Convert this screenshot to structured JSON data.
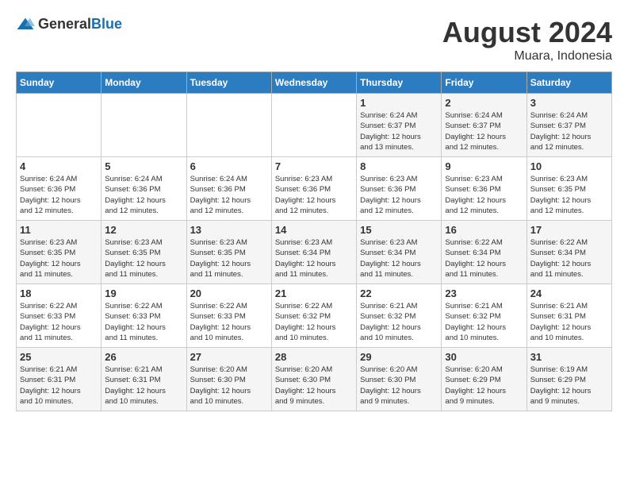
{
  "header": {
    "logo_general": "General",
    "logo_blue": "Blue",
    "month_year": "August 2024",
    "location": "Muara, Indonesia"
  },
  "days_of_week": [
    "Sunday",
    "Monday",
    "Tuesday",
    "Wednesday",
    "Thursday",
    "Friday",
    "Saturday"
  ],
  "weeks": [
    [
      {
        "day": "",
        "info": ""
      },
      {
        "day": "",
        "info": ""
      },
      {
        "day": "",
        "info": ""
      },
      {
        "day": "",
        "info": ""
      },
      {
        "day": "1",
        "info": "Sunrise: 6:24 AM\nSunset: 6:37 PM\nDaylight: 12 hours\nand 13 minutes."
      },
      {
        "day": "2",
        "info": "Sunrise: 6:24 AM\nSunset: 6:37 PM\nDaylight: 12 hours\nand 12 minutes."
      },
      {
        "day": "3",
        "info": "Sunrise: 6:24 AM\nSunset: 6:37 PM\nDaylight: 12 hours\nand 12 minutes."
      }
    ],
    [
      {
        "day": "4",
        "info": "Sunrise: 6:24 AM\nSunset: 6:36 PM\nDaylight: 12 hours\nand 12 minutes."
      },
      {
        "day": "5",
        "info": "Sunrise: 6:24 AM\nSunset: 6:36 PM\nDaylight: 12 hours\nand 12 minutes."
      },
      {
        "day": "6",
        "info": "Sunrise: 6:24 AM\nSunset: 6:36 PM\nDaylight: 12 hours\nand 12 minutes."
      },
      {
        "day": "7",
        "info": "Sunrise: 6:23 AM\nSunset: 6:36 PM\nDaylight: 12 hours\nand 12 minutes."
      },
      {
        "day": "8",
        "info": "Sunrise: 6:23 AM\nSunset: 6:36 PM\nDaylight: 12 hours\nand 12 minutes."
      },
      {
        "day": "9",
        "info": "Sunrise: 6:23 AM\nSunset: 6:36 PM\nDaylight: 12 hours\nand 12 minutes."
      },
      {
        "day": "10",
        "info": "Sunrise: 6:23 AM\nSunset: 6:35 PM\nDaylight: 12 hours\nand 12 minutes."
      }
    ],
    [
      {
        "day": "11",
        "info": "Sunrise: 6:23 AM\nSunset: 6:35 PM\nDaylight: 12 hours\nand 11 minutes."
      },
      {
        "day": "12",
        "info": "Sunrise: 6:23 AM\nSunset: 6:35 PM\nDaylight: 12 hours\nand 11 minutes."
      },
      {
        "day": "13",
        "info": "Sunrise: 6:23 AM\nSunset: 6:35 PM\nDaylight: 12 hours\nand 11 minutes."
      },
      {
        "day": "14",
        "info": "Sunrise: 6:23 AM\nSunset: 6:34 PM\nDaylight: 12 hours\nand 11 minutes."
      },
      {
        "day": "15",
        "info": "Sunrise: 6:23 AM\nSunset: 6:34 PM\nDaylight: 12 hours\nand 11 minutes."
      },
      {
        "day": "16",
        "info": "Sunrise: 6:22 AM\nSunset: 6:34 PM\nDaylight: 12 hours\nand 11 minutes."
      },
      {
        "day": "17",
        "info": "Sunrise: 6:22 AM\nSunset: 6:34 PM\nDaylight: 12 hours\nand 11 minutes."
      }
    ],
    [
      {
        "day": "18",
        "info": "Sunrise: 6:22 AM\nSunset: 6:33 PM\nDaylight: 12 hours\nand 11 minutes."
      },
      {
        "day": "19",
        "info": "Sunrise: 6:22 AM\nSunset: 6:33 PM\nDaylight: 12 hours\nand 11 minutes."
      },
      {
        "day": "20",
        "info": "Sunrise: 6:22 AM\nSunset: 6:33 PM\nDaylight: 12 hours\nand 10 minutes."
      },
      {
        "day": "21",
        "info": "Sunrise: 6:22 AM\nSunset: 6:32 PM\nDaylight: 12 hours\nand 10 minutes."
      },
      {
        "day": "22",
        "info": "Sunrise: 6:21 AM\nSunset: 6:32 PM\nDaylight: 12 hours\nand 10 minutes."
      },
      {
        "day": "23",
        "info": "Sunrise: 6:21 AM\nSunset: 6:32 PM\nDaylight: 12 hours\nand 10 minutes."
      },
      {
        "day": "24",
        "info": "Sunrise: 6:21 AM\nSunset: 6:31 PM\nDaylight: 12 hours\nand 10 minutes."
      }
    ],
    [
      {
        "day": "25",
        "info": "Sunrise: 6:21 AM\nSunset: 6:31 PM\nDaylight: 12 hours\nand 10 minutes."
      },
      {
        "day": "26",
        "info": "Sunrise: 6:21 AM\nSunset: 6:31 PM\nDaylight: 12 hours\nand 10 minutes."
      },
      {
        "day": "27",
        "info": "Sunrise: 6:20 AM\nSunset: 6:30 PM\nDaylight: 12 hours\nand 10 minutes."
      },
      {
        "day": "28",
        "info": "Sunrise: 6:20 AM\nSunset: 6:30 PM\nDaylight: 12 hours\nand 9 minutes."
      },
      {
        "day": "29",
        "info": "Sunrise: 6:20 AM\nSunset: 6:30 PM\nDaylight: 12 hours\nand 9 minutes."
      },
      {
        "day": "30",
        "info": "Sunrise: 6:20 AM\nSunset: 6:29 PM\nDaylight: 12 hours\nand 9 minutes."
      },
      {
        "day": "31",
        "info": "Sunrise: 6:19 AM\nSunset: 6:29 PM\nDaylight: 12 hours\nand 9 minutes."
      }
    ]
  ]
}
